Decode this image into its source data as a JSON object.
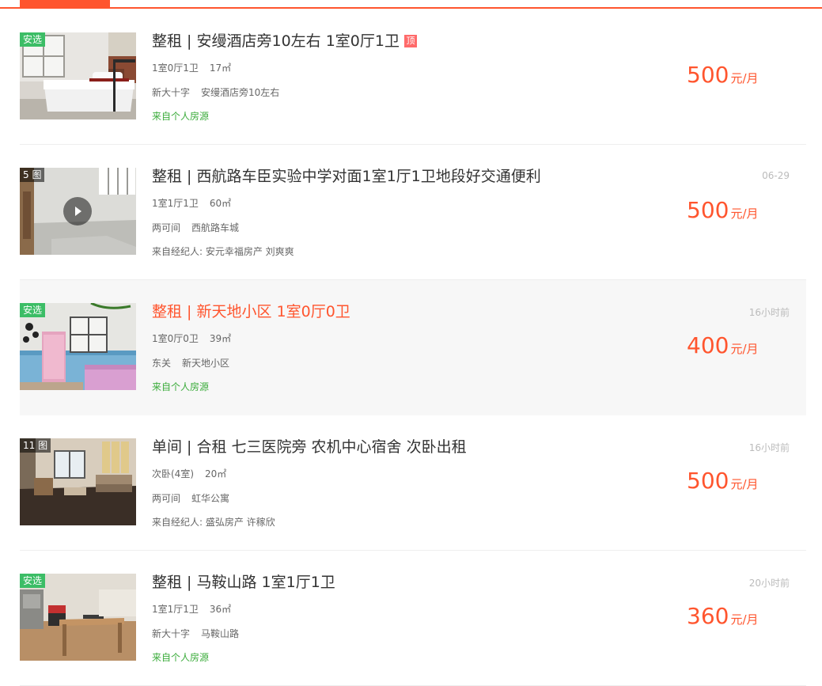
{
  "listings": [
    {
      "title": "整租 | 安缦酒店旁10左右 1室0厅1卫",
      "top_badge": "顶",
      "photo_badge": "安选",
      "layout": "1室0厅1卫",
      "area": "17㎡",
      "district": "新大十字",
      "address": "安缦酒店旁10左右",
      "source": "来自个人房源",
      "time": "",
      "price": "500",
      "unit": "元/月"
    },
    {
      "title": "整租 | 西航路车臣实验中学对面1室1厅1卫地段好交通便利",
      "photo_badge": "5 图",
      "layout": "1室1厅1卫",
      "area": "60㎡",
      "district": "两可间",
      "address": "西航路车城",
      "source": "来自经纪人: 安元幸福房产 刘爽爽",
      "time": "06-29",
      "price": "500",
      "unit": "元/月"
    },
    {
      "title": "整租 | 新天地小区 1室0厅0卫",
      "photo_badge": "安选",
      "layout": "1室0厅0卫",
      "area": "39㎡",
      "district": "东关",
      "address": "新天地小区",
      "source": "来自个人房源",
      "time": "16小时前",
      "price": "400",
      "unit": "元/月"
    },
    {
      "title": "单间 | 合租 七三医院旁 农机中心宿舍 次卧出租",
      "photo_badge": "11 图",
      "layout": "次卧(4室)",
      "area": "20㎡",
      "district": "两可间",
      "address": "虹华公寓",
      "source": "来自经纪人: 盛弘房产 许稼欣",
      "time": "16小时前",
      "price": "500",
      "unit": "元/月"
    },
    {
      "title": "整租 | 马鞍山路 1室1厅1卫",
      "photo_badge": "安选",
      "layout": "1室1厅1卫",
      "area": "36㎡",
      "district": "新大十字",
      "address": "马鞍山路",
      "source": "来自个人房源",
      "time": "20小时前",
      "price": "360",
      "unit": "元/月"
    }
  ],
  "colors": {
    "accent": "#ff552e",
    "badge_green": "#3cbd66",
    "source_green": "#3cac3c",
    "top_badge": "#ff6a6a",
    "hover_bg": "#f7f7f7"
  }
}
